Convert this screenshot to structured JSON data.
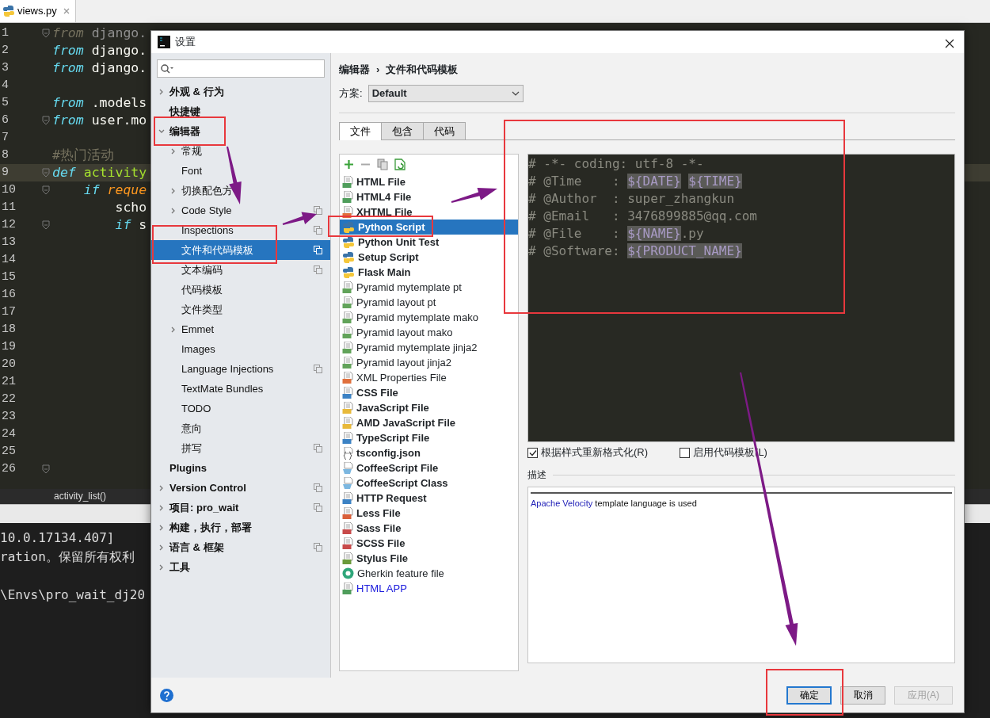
{
  "ide": {
    "tab": {
      "label": "views.py",
      "selected": true
    },
    "code_lines": [
      {
        "number": "1",
        "fold": true,
        "current": false,
        "tokens": [
          {
            "kind": "dim-keyword",
            "text": "from"
          },
          {
            "kind": "dim",
            "text": " django."
          }
        ]
      },
      {
        "number": "2",
        "fold": false,
        "current": false,
        "tokens": [
          {
            "kind": "keyword",
            "text": "from"
          },
          {
            "kind": "plain",
            "text": " django."
          }
        ]
      },
      {
        "number": "3",
        "fold": false,
        "current": false,
        "tokens": [
          {
            "kind": "keyword",
            "text": "from"
          },
          {
            "kind": "plain",
            "text": " django."
          }
        ]
      },
      {
        "number": "4",
        "fold": false,
        "current": false
      },
      {
        "number": "5",
        "fold": false,
        "current": false,
        "tokens": [
          {
            "kind": "keyword",
            "text": "from"
          },
          {
            "kind": "plain",
            "text": " .models"
          }
        ]
      },
      {
        "number": "6",
        "fold": true,
        "current": false,
        "tokens": [
          {
            "kind": "keyword",
            "text": "from"
          },
          {
            "kind": "plain",
            "text": " user.mo"
          }
        ]
      },
      {
        "number": "7",
        "fold": false,
        "current": false
      },
      {
        "number": "8",
        "fold": false,
        "current": false,
        "tokens": [
          {
            "kind": "comment",
            "text": "#热门活动"
          }
        ]
      },
      {
        "number": "9",
        "fold": true,
        "current": true,
        "tokens": [
          {
            "kind": "keyword",
            "text": "def"
          },
          {
            "kind": "function",
            "text": " activity"
          }
        ]
      },
      {
        "number": "10",
        "fold": true,
        "current": false,
        "tokens": [
          {
            "kind": "keyword",
            "text": "    if"
          },
          {
            "kind": "param",
            "text": " reque"
          }
        ]
      },
      {
        "number": "11",
        "fold": false,
        "current": false,
        "tokens": [
          {
            "kind": "plain",
            "text": "        scho"
          }
        ]
      },
      {
        "number": "12",
        "fold": true,
        "current": false,
        "tokens": [
          {
            "kind": "keyword",
            "text": "        if"
          },
          {
            "kind": "plain",
            "text": " s"
          }
        ]
      },
      {
        "number": "13",
        "fold": false,
        "current": false
      },
      {
        "number": "14",
        "fold": false,
        "current": false
      },
      {
        "number": "15",
        "fold": false,
        "current": false
      },
      {
        "number": "16",
        "fold": false,
        "current": false
      },
      {
        "number": "17",
        "fold": false,
        "current": false
      },
      {
        "number": "18",
        "fold": false,
        "current": false
      },
      {
        "number": "19",
        "fold": false,
        "current": false
      },
      {
        "number": "20",
        "fold": false,
        "current": false
      },
      {
        "number": "21",
        "fold": false,
        "current": false
      },
      {
        "number": "22",
        "fold": false,
        "current": false
      },
      {
        "number": "23",
        "fold": false,
        "current": false
      },
      {
        "number": "24",
        "fold": false,
        "current": false
      },
      {
        "number": "25",
        "fold": false,
        "current": false
      },
      {
        "number": "26",
        "fold": true,
        "current": false
      }
    ],
    "breadcrumb": "activity_list()",
    "terminal_lines": [
      "10.0.17134.407]",
      "ration。保留所有权利",
      "\\Envs\\pro_wait_dj20"
    ]
  },
  "dialog": {
    "title": "设置",
    "sidebar": {
      "items": [
        {
          "label": "外观 & 行为",
          "expanded": false,
          "selected": false,
          "shared": false
        },
        {
          "label": "快捷键",
          "selected": false,
          "shared": false
        },
        {
          "label": "编辑器",
          "expanded": true,
          "selected": false,
          "shared": false,
          "children": [
            {
              "label": "常规",
              "expanded": false,
              "selected": false,
              "shared": false
            },
            {
              "label": "Font",
              "selected": false,
              "shared": false
            },
            {
              "label": "切换配色方",
              "expanded": false,
              "selected": false,
              "shared": false
            },
            {
              "label": "Code Style",
              "expanded": false,
              "selected": false,
              "shared": true
            },
            {
              "label": "Inspections",
              "selected": false,
              "shared": true
            },
            {
              "label": "文件和代码模板",
              "selected": true,
              "shared": true
            },
            {
              "label": "文本编码",
              "selected": false,
              "shared": true
            },
            {
              "label": "代码模板",
              "selected": false,
              "shared": false
            },
            {
              "label": "文件类型",
              "selected": false,
              "shared": false
            },
            {
              "label": "Emmet",
              "expanded": false,
              "selected": false,
              "shared": false
            },
            {
              "label": "Images",
              "selected": false,
              "shared": false
            },
            {
              "label": "Language Injections",
              "selected": false,
              "shared": true
            },
            {
              "label": "TextMate Bundles",
              "selected": false,
              "shared": false
            },
            {
              "label": "TODO",
              "selected": false,
              "shared": false
            },
            {
              "label": "意向",
              "selected": false,
              "shared": false
            },
            {
              "label": "拼写",
              "selected": false,
              "shared": true
            }
          ]
        },
        {
          "label": "Plugins",
          "selected": false,
          "shared": false
        },
        {
          "label": "Version Control",
          "expanded": false,
          "selected": false,
          "shared": true
        },
        {
          "label": "项目: pro_wait",
          "expanded": false,
          "selected": false,
          "shared": true
        },
        {
          "label": "构建，执行，部署",
          "expanded": false,
          "selected": false,
          "shared": false
        },
        {
          "label": "语言 & 框架",
          "expanded": false,
          "selected": false,
          "shared": true
        },
        {
          "label": "工具",
          "expanded": false,
          "selected": false,
          "shared": false
        }
      ]
    },
    "breadcrumb": [
      "编辑器",
      "›",
      "文件和代码模板"
    ],
    "scheme": {
      "label": "方案:",
      "value": "Default"
    },
    "tabs": [
      {
        "label": "文件",
        "selected": true
      },
      {
        "label": "包含",
        "selected": false
      },
      {
        "label": "代码",
        "selected": false
      }
    ],
    "templates": [
      {
        "name": "HTML File",
        "kind": "file",
        "color": "#4f9d5b",
        "bold": true,
        "blue": false,
        "selected": false
      },
      {
        "name": "HTML4 File",
        "kind": "file",
        "color": "#4f9d5b",
        "bold": true,
        "blue": false,
        "selected": false
      },
      {
        "name": "XHTML File",
        "kind": "file",
        "color": "#e0703c",
        "bold": true,
        "blue": false,
        "selected": false
      },
      {
        "name": "Python Script",
        "kind": "python",
        "bold": true,
        "blue": false,
        "selected": true
      },
      {
        "name": "Python Unit Test",
        "kind": "python",
        "bold": true,
        "blue": false,
        "selected": false
      },
      {
        "name": "Setup Script",
        "kind": "python",
        "bold": true,
        "blue": false,
        "selected": false
      },
      {
        "name": "Flask Main",
        "kind": "python",
        "bold": true,
        "blue": false,
        "selected": false
      },
      {
        "name": "Pyramid mytemplate pt",
        "kind": "file",
        "color": "#62a35a",
        "bold": false,
        "blue": false,
        "selected": false
      },
      {
        "name": "Pyramid layout pt",
        "kind": "file",
        "color": "#62a35a",
        "bold": false,
        "blue": false,
        "selected": false
      },
      {
        "name": "Pyramid mytemplate mako",
        "kind": "file",
        "color": "#62a35a",
        "bold": false,
        "blue": false,
        "selected": false
      },
      {
        "name": "Pyramid layout mako",
        "kind": "file",
        "color": "#62a35a",
        "bold": false,
        "blue": false,
        "selected": false
      },
      {
        "name": "Pyramid mytemplate jinja2",
        "kind": "file",
        "color": "#62a35a",
        "bold": false,
        "blue": false,
        "selected": false
      },
      {
        "name": "Pyramid layout jinja2",
        "kind": "file",
        "color": "#62a35a",
        "bold": false,
        "blue": false,
        "selected": false
      },
      {
        "name": "XML Properties File",
        "kind": "file",
        "color": "#e0703c",
        "bold": false,
        "blue": false,
        "selected": false
      },
      {
        "name": "CSS File",
        "kind": "file",
        "color": "#3c82c4",
        "bold": true,
        "blue": false,
        "selected": false
      },
      {
        "name": "JavaScript File",
        "kind": "file",
        "color": "#e8b93a",
        "bold": true,
        "blue": false,
        "selected": false
      },
      {
        "name": "AMD JavaScript File",
        "kind": "file",
        "color": "#e8b93a",
        "bold": true,
        "blue": false,
        "selected": false
      },
      {
        "name": "TypeScript File",
        "kind": "file",
        "color": "#3c82c4",
        "bold": true,
        "blue": false,
        "selected": false
      },
      {
        "name": "tsconfig.json",
        "kind": "json",
        "bold": true,
        "blue": false,
        "selected": false
      },
      {
        "name": "CoffeeScript File",
        "kind": "coffee",
        "bold": true,
        "blue": false,
        "selected": false
      },
      {
        "name": "CoffeeScript Class",
        "kind": "coffee",
        "bold": true,
        "blue": false,
        "selected": false
      },
      {
        "name": "HTTP Request",
        "kind": "file",
        "color": "#3c82c4",
        "bold": true,
        "blue": false,
        "selected": false
      },
      {
        "name": "Less File",
        "kind": "file",
        "color": "#d9603b",
        "bold": true,
        "blue": false,
        "selected": false
      },
      {
        "name": "Sass File",
        "kind": "file",
        "color": "#c84a4a",
        "bold": true,
        "blue": false,
        "selected": false
      },
      {
        "name": "SCSS File",
        "kind": "file",
        "color": "#c84a4a",
        "bold": true,
        "blue": false,
        "selected": false
      },
      {
        "name": "Stylus File",
        "kind": "file",
        "color": "#6a9a3a",
        "bold": true,
        "blue": false,
        "selected": false
      },
      {
        "name": "Gherkin feature file",
        "kind": "gherkin",
        "bold": false,
        "blue": false,
        "selected": false
      },
      {
        "name": "HTML APP",
        "kind": "file",
        "color": "#4f9d5b",
        "bold": false,
        "blue": true,
        "selected": false
      }
    ],
    "template_code": [
      [
        {
          "kind": "text",
          "text": "# -*- coding: utf-8 -*-"
        }
      ],
      [
        {
          "kind": "text",
          "text": "# @Time    : "
        },
        {
          "kind": "var",
          "text": "${DATE}"
        },
        {
          "kind": "var",
          "text": "${TIME}"
        }
      ],
      [
        {
          "kind": "text",
          "text": "# @Author  : super_zhangkun"
        }
      ],
      [
        {
          "kind": "text",
          "text": "# @Email   : 3476899885@qq.com"
        }
      ],
      [
        {
          "kind": "text",
          "text": "# @File    : "
        },
        {
          "kind": "var",
          "text": "${NAME}"
        },
        {
          "kind": "text",
          "text": ".py"
        }
      ],
      [
        {
          "kind": "text",
          "text": "# @Software: "
        },
        {
          "kind": "var",
          "text": "${PRODUCT_NAME}"
        }
      ]
    ],
    "options": [
      {
        "label": "根据样式重新格式化(R)",
        "checked": true
      },
      {
        "label": "启用代码模板(L)",
        "checked": false
      }
    ],
    "description_label": "描述",
    "description": {
      "link": "Apache Velocity",
      "text": " template language is used"
    },
    "buttons": [
      {
        "label": "确定",
        "default": true,
        "disabled": false
      },
      {
        "label": "取消",
        "default": false,
        "disabled": false
      },
      {
        "label": "应用(A)",
        "default": false,
        "disabled": true
      }
    ]
  },
  "annotations": [
    {
      "kind": "box"
    },
    {
      "kind": "box"
    },
    {
      "kind": "box"
    },
    {
      "kind": "box"
    },
    {
      "kind": "box"
    },
    {
      "kind": "arrow"
    },
    {
      "kind": "arrow"
    },
    {
      "kind": "arrow"
    },
    {
      "kind": "arrow"
    }
  ]
}
